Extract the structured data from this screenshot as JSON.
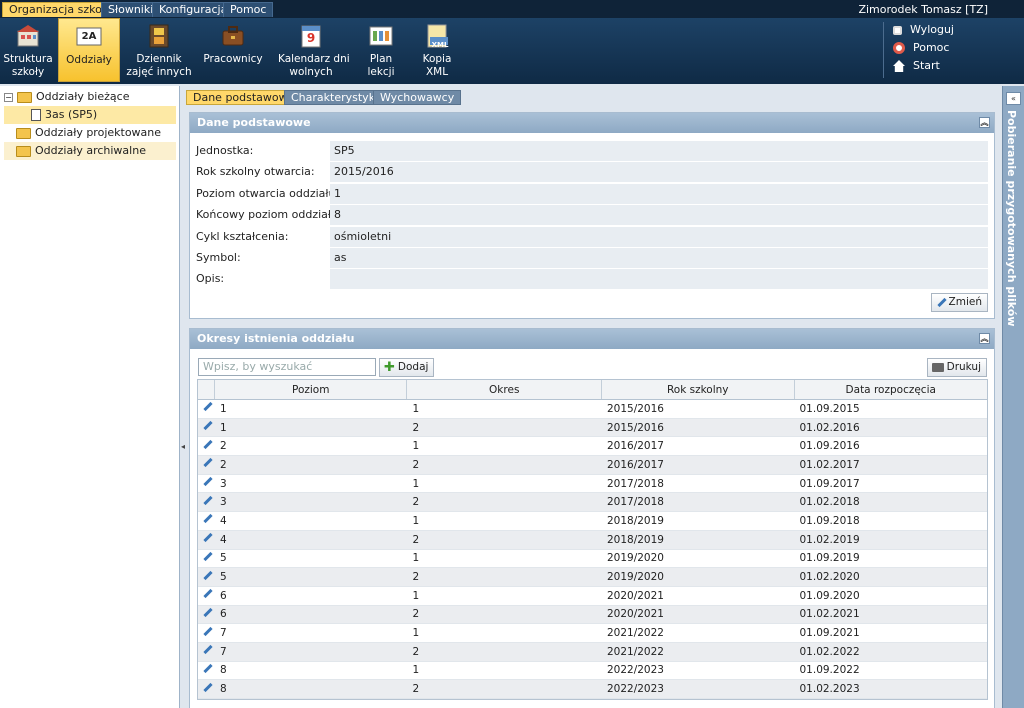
{
  "menubar": {
    "tabs": [
      "Organizacja szkoły",
      "Słowniki",
      "Konfiguracja",
      "Pomoc"
    ],
    "active_tab": "Organizacja szkoły",
    "username": "Zimorodek Tomasz [TZ]"
  },
  "ribbon": {
    "buttons": [
      {
        "label": "Struktura\nszkoły",
        "icon": "school-structure-icon"
      },
      {
        "label": "Oddziały",
        "icon": "class-2a-icon",
        "icon_text": "2A"
      },
      {
        "label": "Dziennik\nzajęć innych",
        "icon": "film-journal-icon"
      },
      {
        "label": "Pracownicy",
        "icon": "briefcase-icon"
      },
      {
        "label": "Kalendarz dni\nwolnych",
        "icon": "calendar-icon",
        "icon_text": "9"
      },
      {
        "label": "Plan lekcji",
        "icon": "lesson-plan-icon"
      },
      {
        "label": "Kopia\nXML",
        "icon": "xml-file-icon",
        "icon_text": "XML"
      }
    ],
    "active_button": "Oddziały",
    "links": [
      {
        "label": "Wyloguj",
        "icon": "lock-icon"
      },
      {
        "label": "Pomoc",
        "icon": "lifebuoy-icon"
      },
      {
        "label": "Start",
        "icon": "home-icon"
      }
    ]
  },
  "tree": {
    "root": "Oddziały bieżące",
    "child": "3as (SP5)",
    "projected": "Oddziały projektowane",
    "archived": "Oddziały archiwalne"
  },
  "tabs": [
    "Dane podstawowe",
    "Charakterystyka",
    "Wychowawcy"
  ],
  "basic": {
    "title": "Dane podstawowe",
    "fields": [
      {
        "label": "Jednostka:",
        "value": "SP5"
      },
      {
        "label": "Rok szkolny otwarcia:",
        "value": "2015/2016"
      },
      {
        "label": "Poziom otwarcia oddziału:",
        "value": "1"
      },
      {
        "label": "Końcowy poziom oddziału:",
        "value": "8"
      },
      {
        "label": "Cykl kształcenia:",
        "value": "ośmioletni"
      },
      {
        "label": "Symbol:",
        "value": "as"
      },
      {
        "label": "Opis:",
        "value": ""
      }
    ],
    "change_button": "Zmień"
  },
  "periods": {
    "title": "Okresy istnienia oddziału",
    "search_placeholder": "Wpisz, by wyszukać",
    "add_button": "Dodaj",
    "print_button": "Drukuj",
    "columns": [
      "Poziom",
      "Okres",
      "Rok szkolny",
      "Data rozpoczęcia"
    ],
    "rows": [
      [
        "1",
        "1",
        "2015/2016",
        "01.09.2015"
      ],
      [
        "1",
        "2",
        "2015/2016",
        "01.02.2016"
      ],
      [
        "2",
        "1",
        "2016/2017",
        "01.09.2016"
      ],
      [
        "2",
        "2",
        "2016/2017",
        "01.02.2017"
      ],
      [
        "3",
        "1",
        "2017/2018",
        "01.09.2017"
      ],
      [
        "3",
        "2",
        "2017/2018",
        "01.02.2018"
      ],
      [
        "4",
        "1",
        "2018/2019",
        "01.09.2018"
      ],
      [
        "4",
        "2",
        "2018/2019",
        "01.02.2019"
      ],
      [
        "5",
        "1",
        "2019/2020",
        "01.09.2019"
      ],
      [
        "5",
        "2",
        "2019/2020",
        "01.02.2020"
      ],
      [
        "6",
        "1",
        "2020/2021",
        "01.09.2020"
      ],
      [
        "6",
        "2",
        "2020/2021",
        "01.02.2021"
      ],
      [
        "7",
        "1",
        "2021/2022",
        "01.09.2021"
      ],
      [
        "7",
        "2",
        "2021/2022",
        "01.02.2022"
      ],
      [
        "8",
        "1",
        "2022/2023",
        "01.09.2022"
      ],
      [
        "8",
        "2",
        "2022/2023",
        "01.02.2023"
      ]
    ]
  },
  "sidebar_right": {
    "label": "Pobieranie przygotowanych plików"
  }
}
